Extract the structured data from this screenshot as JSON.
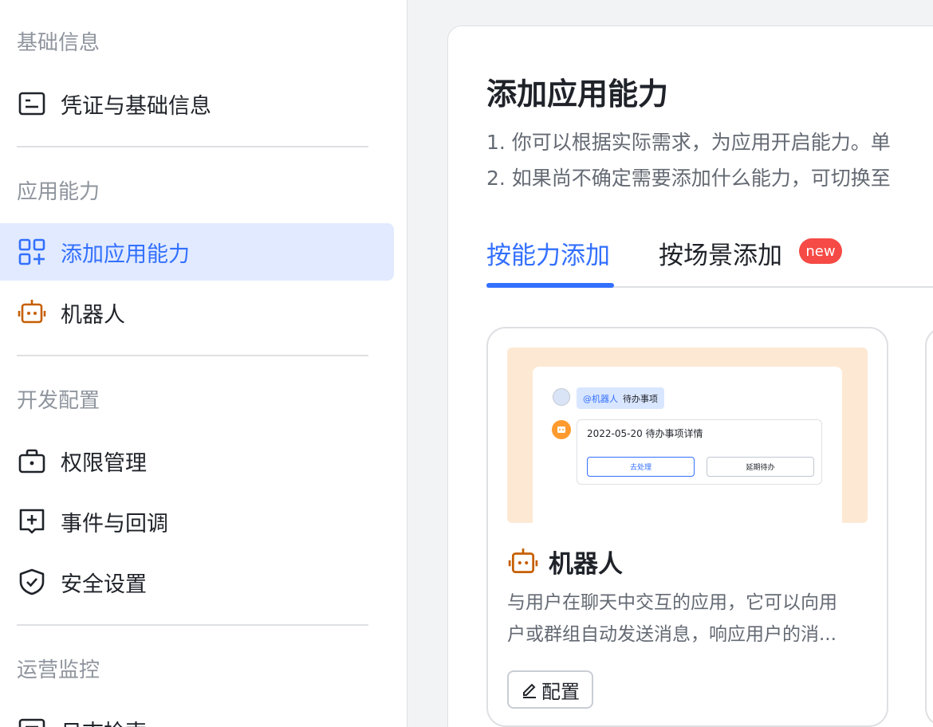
{
  "sidebar": {
    "sections": [
      {
        "title": "基础信息"
      },
      {
        "title": "应用能力"
      },
      {
        "title": "开发配置"
      },
      {
        "title": "运营监控"
      }
    ],
    "items": [
      {
        "label": "凭证与基础信息",
        "icon": "id-card-icon"
      },
      {
        "label": "添加应用能力",
        "icon": "add-grid-icon",
        "active": true
      },
      {
        "label": "机器人",
        "icon": "robot-icon"
      },
      {
        "label": "权限管理",
        "icon": "lock-bag-icon"
      },
      {
        "label": "事件与回调",
        "icon": "event-plus-icon"
      },
      {
        "label": "安全设置",
        "icon": "shield-icon"
      },
      {
        "label": "日志检索",
        "icon": "log-icon"
      }
    ]
  },
  "main": {
    "title": "添加应用能力",
    "desc_lines": [
      "1. 你可以根据实际需求，为应用开启能力。单",
      "2. 如果尚不确定需要添加什么能力，可切换至"
    ],
    "tabs": [
      {
        "label": "按能力添加",
        "active": true
      },
      {
        "label": "按场景添加",
        "badge": "new"
      }
    ],
    "cards": [
      {
        "name": "机器人",
        "desc_lines": [
          "与用户在聊天中交互的应用，它可以向用",
          "户或群组自动发送消息，响应用户的消..."
        ],
        "button": "配置",
        "preview": {
          "mention": "@机器人",
          "mention_text": "待办事项",
          "message": "2022-05-20 待办事项详情",
          "primary_btn": "去处理",
          "secondary_btn": "延期待办"
        }
      }
    ]
  },
  "colors": {
    "accent": "#3370ff",
    "active_bg": "#e1eaff",
    "badge": "#f54a45",
    "robot_icon": "#c65f00",
    "preview_bg": "#fde9d3"
  }
}
